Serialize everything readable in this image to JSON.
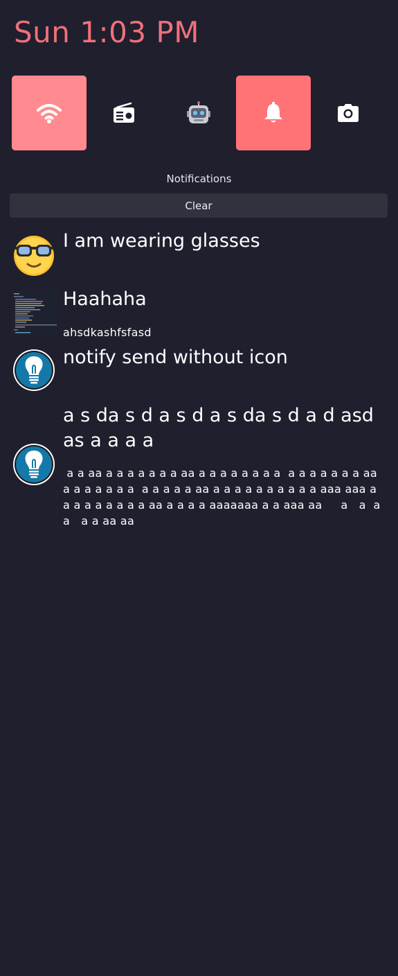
{
  "clock": {
    "text": "Sun 1:03 PM",
    "color": "#f0707a"
  },
  "quick_toggles": [
    {
      "icon": "wifi-icon",
      "active": true,
      "color": "#ff8a8f"
    },
    {
      "icon": "radio-icon",
      "active": false
    },
    {
      "icon": "robot-icon",
      "active": false
    },
    {
      "icon": "bell-icon",
      "active": true,
      "color": "#ff7377"
    },
    {
      "icon": "camera-icon",
      "active": false
    }
  ],
  "notifications_panel": {
    "heading": "Notifications",
    "clear_label": "Clear"
  },
  "notifications": [
    {
      "icon": "glasses-emoji-icon",
      "title": "I am wearing glasses",
      "body": ""
    },
    {
      "icon": "code-screenshot-thumbnail",
      "title": "Haahaha",
      "body": "ahsdkashfsfasd"
    },
    {
      "icon": "lightbulb-icon",
      "title": "notify send without icon",
      "body": ""
    },
    {
      "icon": "lightbulb-icon",
      "title": "a s da s d a s d a s da s d a d asd as a a a a",
      "body": " a a aa a a a a a a a aa a a a a a a a a  a a a a a a a aa a a a a a a a  a a a a a aa a a a a a a a a a a aaa aaa a a a a a a a a a aa a a a a aaaaaaa a a aaa aa     a   a  a   a   a a aa aa"
    }
  ],
  "colors": {
    "background": "#1f1f2e",
    "button_bg": "#32323f",
    "accent": "#f0707a"
  }
}
